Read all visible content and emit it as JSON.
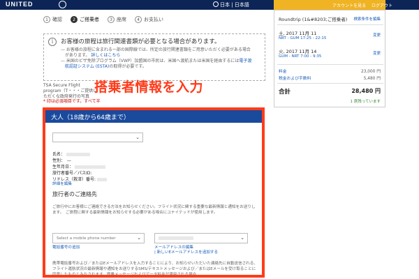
{
  "header": {
    "logo": "UNITED",
    "language": "日本 | 日本語",
    "account_link": "アカウントを見る",
    "logout_link": "ログアウト"
  },
  "steps": [
    {
      "num": "1",
      "label": "確認"
    },
    {
      "num": "2",
      "label": "ご搭乗者"
    },
    {
      "num": "3",
      "label": "座席"
    },
    {
      "num": "4",
      "label": "お支払い"
    }
  ],
  "info": {
    "title": "お客様の旅程は旅行関連書類が必要となる場合があります。",
    "line1": "— お客様の旅程に含まれる一部の国際線では、所定の旅行関連書類をご用意いただく必要がある場合",
    "line1b": "があります。",
    "line1_link": "詳しくはこちら",
    "line2": "— 米国のビザ免除プログラム（VWP）加盟国の市民は、米国へ渡航または米国を経由するには",
    "line2_link1": "電子渡",
    "line2_link2": "航認証システム (ESTA)",
    "line2b": "の取得が必要です。"
  },
  "tsa": "TSA Secure Flight program（T・・・ご提供いただくな政府発行の写真",
  "required_note": "* 印は必須項目です。すべて半",
  "overlay_text": "搭乗者情報を入力",
  "adult": {
    "header": "大人（18歳から64歳まで）",
    "fields": [
      {
        "label": "氏名："
      },
      {
        "label": "性別：　—"
      },
      {
        "label": "生年月日："
      },
      {
        "label": "旅行者番号／パスID:"
      },
      {
        "label": "リドレス（救済）番号:"
      }
    ],
    "edit_link": "詳細を編集",
    "contact_title": "旅行者のご連絡先",
    "contact_para": "ご旅行中にお客様にご連絡できる方法をお知らせください。フライト状況に関する重要な最新情報と通知をお送りします。　ご旅程に関する最新情報をお知らせする必要がある場合にユナイテッドが使用します。",
    "phone_placeholder": "Select a mobile phone number",
    "add_phone_link": "電話番号の追加",
    "edit_email_link": "メールアドレスの編集",
    "new_email_link": "| 新しいEメールアドレスを追加する",
    "bottom_para": "携帯電話番号および／またはEメールアドレスを入力することにより、お知らせいただいた連絡先に自動送信される、フライト運航状況の最新情報や通知をお送りするSMS/テキストメッセージおよび／またはEメールを受け取ることに同意したものとみなされます。搭乗メッセージおよびデータ料金が適用される場合"
  },
  "summary": {
    "title": "Roundtrip (1&#8203;ご搭乗者)",
    "edit_link": "検索条件を編集",
    "flights": [
      {
        "date": "土, 2017 11月 11",
        "route": "NRT - GUM 17:25 - 22:15",
        "change": "変更"
      },
      {
        "date": "火, 2017 11月 14",
        "route": "GUM - NRT 7:00 - 9:35",
        "change": "変更"
      }
    ],
    "fare_label": "料金",
    "fare_value": "23,000 円",
    "tax_label": "税金および手数料",
    "tax_value": "5,480 円",
    "total_label": "合計",
    "total_value": "28,480 円",
    "seats_left": "1 席残っています"
  },
  "colors": {
    "header_bg": "#0d2556",
    "accent_yellow": "#f0b323",
    "highlight_red": "#ff3b1a",
    "panel_blue": "#1a4a9c",
    "link_blue": "#1a5cb8"
  }
}
